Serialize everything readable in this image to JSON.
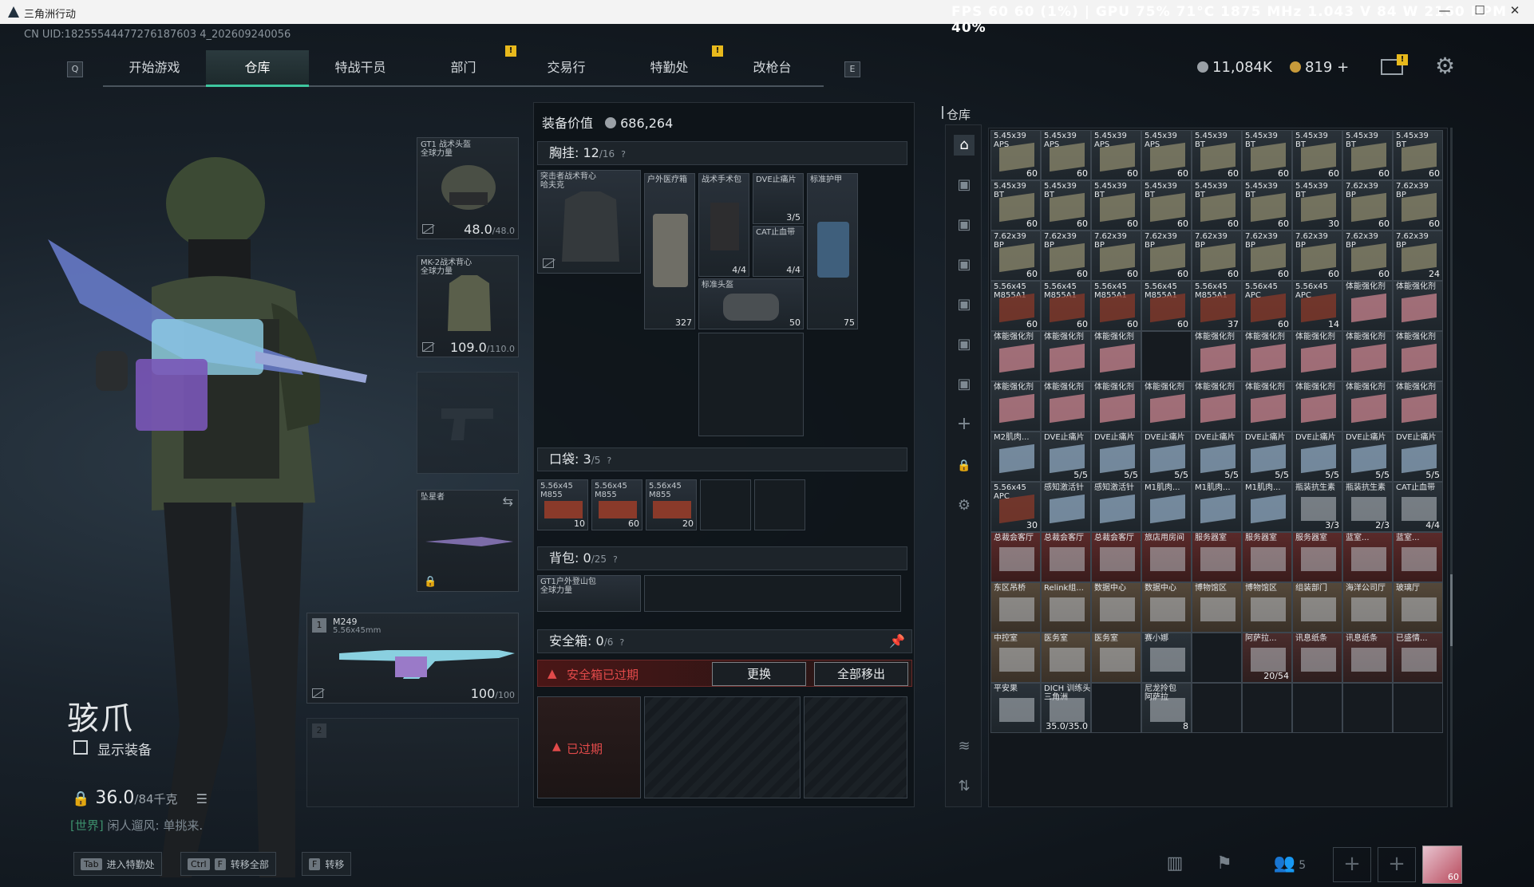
{
  "window": {
    "title": "三角洲行动",
    "overlay": "FPS 60 60 (1%) | GPU 75% 71°C 1875 MHz 1.043 V 84 W 2160 RPM 40%"
  },
  "header": {
    "uid": "CN UID:18255544477276187603 4_202609240056",
    "nav_key_left": "Q",
    "nav_key_right": "E",
    "tabs": [
      "开始游戏",
      "仓库",
      "特战干员",
      "部门",
      "交易行",
      "特勤处",
      "改枪台"
    ],
    "currency1": "11,084K",
    "currency2": "819 +",
    "badge": "!"
  },
  "character": {
    "name": "骇爪",
    "show_equipment": "显示装备",
    "weight": "36.0",
    "weight_max": "/84千克",
    "world_prefix": "[世界]",
    "world_message": "闲人遛风: 单挑来."
  },
  "equipment": {
    "helmet": {
      "name": "GT1 战术头盔\n全球力量",
      "value": "48.0",
      "max": "/48.0"
    },
    "armor": {
      "name": "MK-2战术背心\n全球力量",
      "value": "109.0",
      "max": "/110.0"
    },
    "melee": {
      "name": "坠星者"
    },
    "primary": {
      "slot": "1",
      "name": "M249",
      "ammo": "5.56x45mm",
      "value": "100",
      "max": "/100"
    },
    "secondary": {
      "slot": "2"
    }
  },
  "middle": {
    "equip_value_label": "装备价值",
    "equip_value": "686,264",
    "chest": {
      "label": "胸挂:",
      "count": "12",
      "max": "/16",
      "rig_name": "突击者战术背心\n哈夫克",
      "items": [
        {
          "name": "户外医疗箱",
          "count": "327"
        },
        {
          "name": "战术手术包",
          "count": "4/4"
        },
        {
          "name": "DVE止痛片",
          "count": "3/5"
        },
        {
          "name": "CAT止血带",
          "count": "4/4"
        },
        {
          "name": "标准头盔",
          "count": "50"
        },
        {
          "name": "标准护甲",
          "count": "75"
        }
      ]
    },
    "pocket": {
      "label": "口袋:",
      "count": "3",
      "max": "/5",
      "items": [
        {
          "name": "5.56x45\nM855",
          "count": "10"
        },
        {
          "name": "5.56x45\nM855",
          "count": "60"
        },
        {
          "name": "5.56x45\nM855",
          "count": "20"
        }
      ]
    },
    "backpack": {
      "label": "背包:",
      "count": "0",
      "max": "/25",
      "pack_name": "GT1户外登山包\n全球力量"
    },
    "safebox": {
      "label": "安全箱:",
      "count": "0",
      "max": "/6",
      "expired_msg": "安全箱已过期",
      "replace_btn": "更换",
      "removeall_btn": "全部移出",
      "expired_tag": "已过期"
    }
  },
  "warehouse": {
    "title": "仓库",
    "rows": [
      [
        [
          "5.45x39\nAPS",
          "60"
        ],
        [
          "5.45x39\nAPS",
          "60"
        ],
        [
          "5.45x39\nAPS",
          "60"
        ],
        [
          "5.45x39\nAPS",
          "60"
        ],
        [
          "5.45x39\nBT",
          "60"
        ],
        [
          "5.45x39\nBT",
          "60"
        ],
        [
          "5.45x39\nBT",
          "60"
        ],
        [
          "5.45x39\nBT",
          "60"
        ],
        [
          "5.45x39\nBT",
          "60"
        ]
      ],
      [
        [
          "5.45x39\nBT",
          "60"
        ],
        [
          "5.45x39\nBT",
          "60"
        ],
        [
          "5.45x39\nBT",
          "60"
        ],
        [
          "5.45x39\nBT",
          "60"
        ],
        [
          "5.45x39\nBT",
          "60"
        ],
        [
          "5.45x39\nBT",
          "60"
        ],
        [
          "5.45x39\nBT",
          "30"
        ],
        [
          "7.62x39\nBP",
          "60"
        ],
        [
          "7.62x39\nBP",
          "60"
        ]
      ],
      [
        [
          "7.62x39\nBP",
          "60"
        ],
        [
          "7.62x39\nBP",
          "60"
        ],
        [
          "7.62x39\nBP",
          "60"
        ],
        [
          "7.62x39\nBP",
          "60"
        ],
        [
          "7.62x39\nBP",
          "60"
        ],
        [
          "7.62x39\nBP",
          "60"
        ],
        [
          "7.62x39\nBP",
          "60"
        ],
        [
          "7.62x39\nBP",
          "60"
        ],
        [
          "7.62x39\nBP",
          "24"
        ]
      ],
      [
        [
          "5.56x45\nM855A1",
          "60"
        ],
        [
          "5.56x45\nM855A1",
          "60"
        ],
        [
          "5.56x45\nM855A1",
          "60"
        ],
        [
          "5.56x45\nM855A1",
          "60"
        ],
        [
          "5.56x45\nM855A1",
          "37"
        ],
        [
          "5.56x45\nAPC",
          "60"
        ],
        [
          "5.56x45\nAPC",
          "14"
        ],
        [
          "体能强化剂",
          ""
        ],
        [
          "体能强化剂",
          ""
        ]
      ],
      [
        [
          "体能强化剂",
          ""
        ],
        [
          "体能强化剂",
          ""
        ],
        [
          "体能强化剂",
          ""
        ],
        [
          "",
          ""
        ],
        [
          "体能强化剂",
          ""
        ],
        [
          "体能强化剂",
          ""
        ],
        [
          "体能强化剂",
          ""
        ],
        [
          "体能强化剂",
          ""
        ],
        [
          "体能强化剂",
          ""
        ]
      ],
      [
        [
          "体能强化剂",
          ""
        ],
        [
          "体能强化剂",
          ""
        ],
        [
          "体能强化剂",
          ""
        ],
        [
          "体能强化剂",
          ""
        ],
        [
          "体能强化剂",
          ""
        ],
        [
          "体能强化剂",
          ""
        ],
        [
          "体能强化剂",
          ""
        ],
        [
          "体能强化剂",
          ""
        ],
        [
          "体能强化剂",
          ""
        ]
      ],
      [
        [
          "M2肌肉...",
          ""
        ],
        [
          "DVE止痛片",
          "5/5"
        ],
        [
          "DVE止痛片",
          "5/5"
        ],
        [
          "DVE止痛片",
          "5/5"
        ],
        [
          "DVE止痛片",
          "5/5"
        ],
        [
          "DVE止痛片",
          "5/5"
        ],
        [
          "DVE止痛片",
          "5/5"
        ],
        [
          "DVE止痛片",
          "5/5"
        ],
        [
          "DVE止痛片",
          "5/5"
        ]
      ],
      [
        [
          "5.56x45\nAPC",
          "30"
        ],
        [
          "感知激活针",
          ""
        ],
        [
          "感知激活针",
          ""
        ],
        [
          "M1肌肉...",
          ""
        ],
        [
          "M1肌肉...",
          ""
        ],
        [
          "M1肌肉...",
          ""
        ],
        [
          "瓶装抗生素",
          "3/3"
        ],
        [
          "瓶装抗生素",
          "2/3"
        ],
        [
          "CAT止血带",
          "4/4"
        ]
      ],
      [
        [
          "总裁会客厅",
          ""
        ],
        [
          "总裁会客厅",
          ""
        ],
        [
          "总裁会客厅",
          ""
        ],
        [
          "旅店用房间",
          ""
        ],
        [
          "服务器室",
          ""
        ],
        [
          "服务器室",
          ""
        ],
        [
          "服务器室",
          ""
        ],
        [
          "蓝室...",
          ""
        ],
        [
          "蓝室...",
          ""
        ]
      ],
      [
        [
          "东区吊桥",
          ""
        ],
        [
          "Relink组...",
          ""
        ],
        [
          "数据中心",
          ""
        ],
        [
          "数据中心",
          ""
        ],
        [
          "博物馆区",
          ""
        ],
        [
          "博物馆区",
          ""
        ],
        [
          "组装部门",
          ""
        ],
        [
          "海洋公司厅",
          ""
        ],
        [
          "玻璃厅",
          ""
        ]
      ],
      [
        [
          "中控室",
          ""
        ],
        [
          "医务室",
          ""
        ],
        [
          "医务室",
          ""
        ],
        [
          "赛小娜",
          ""
        ],
        [
          "",
          ""
        ],
        [
          "阿萨拉...",
          "20/54"
        ],
        [
          "讯息纸条",
          ""
        ],
        [
          "讯息纸条",
          ""
        ],
        [
          "已盛情...",
          ""
        ]
      ],
      [
        [
          "平安果",
          ""
        ],
        [
          "DICH 训练头盔\n三角洲",
          "35.0/35.0"
        ],
        [
          "",
          ""
        ],
        [
          "尼龙拎包\n阿萨拉",
          "8"
        ],
        [
          "",
          ""
        ],
        [
          "",
          ""
        ],
        [
          "",
          ""
        ],
        [
          "",
          ""
        ],
        [
          "",
          ""
        ]
      ]
    ]
  },
  "bottom": {
    "k1_cap": "Tab",
    "k1_label": "进入特勤处",
    "k2_cap": "Ctrl",
    "k2_cap2": "F",
    "k2_label": "转移全部",
    "k3_cap": "F",
    "k3_label": "转移",
    "friends": "5",
    "avatar_level": "60"
  }
}
